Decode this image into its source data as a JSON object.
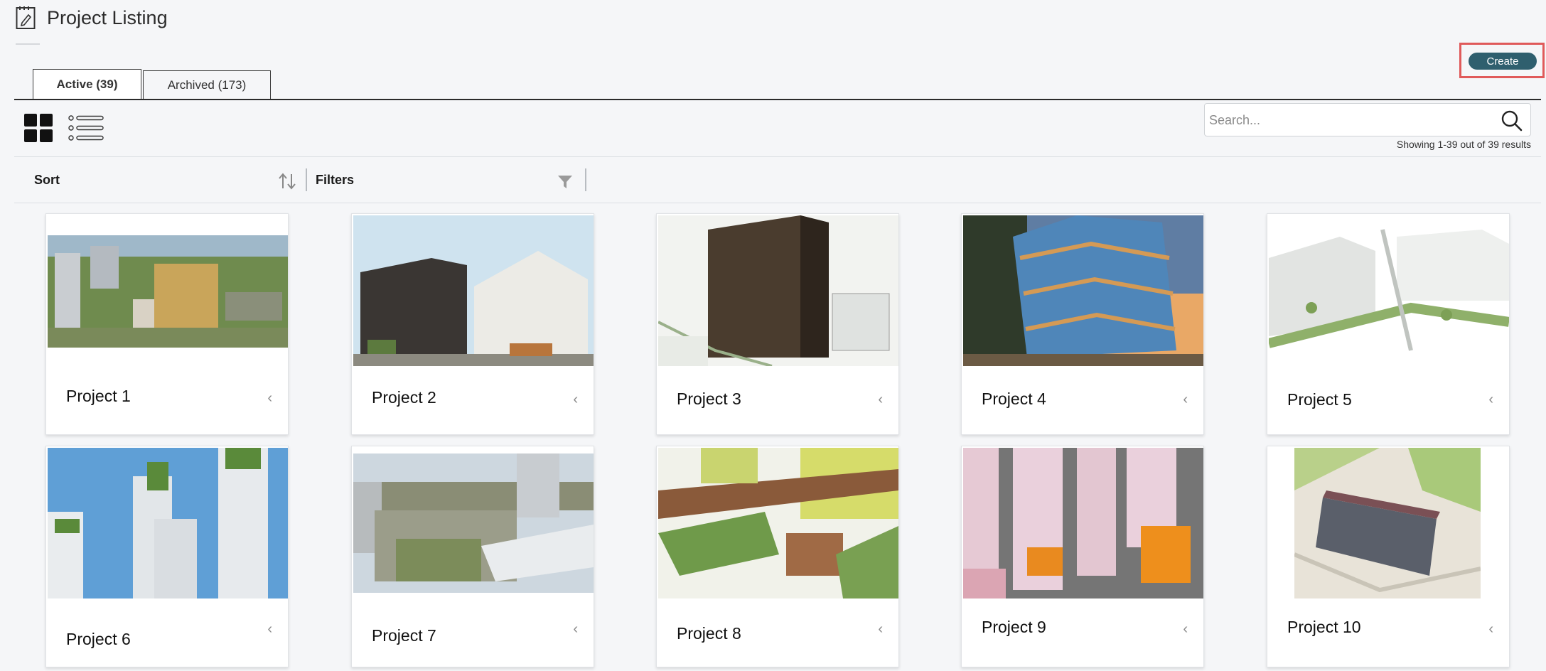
{
  "header": {
    "title": "Project Listing"
  },
  "toolbar": {
    "create_label": "Create"
  },
  "tabs": [
    {
      "label": "Active (39)",
      "active": true
    },
    {
      "label": "Archived (173)",
      "active": false
    }
  ],
  "search": {
    "placeholder": "Search..."
  },
  "results": {
    "text": "Showing 1-39 out of 39 results"
  },
  "filter_bar": {
    "sort_label": "Sort",
    "filters_label": "Filters"
  },
  "projects": [
    {
      "name": "Project 1"
    },
    {
      "name": "Project 2"
    },
    {
      "name": "Project 3"
    },
    {
      "name": "Project 4"
    },
    {
      "name": "Project 5"
    },
    {
      "name": "Project 6"
    },
    {
      "name": "Project 7"
    },
    {
      "name": "Project 8"
    },
    {
      "name": "Project 9"
    },
    {
      "name": "Project 10"
    }
  ],
  "colors": {
    "accent": "#2f5f6e",
    "highlight": "#e05a5a"
  },
  "icons": {
    "page": "document-edit-icon",
    "grid_view": "grid-view-icon",
    "list_view": "list-view-icon",
    "search": "search-icon",
    "sort": "sort-arrows-icon",
    "filter": "filter-funnel-icon",
    "card_menu": "chevron-left-icon"
  }
}
